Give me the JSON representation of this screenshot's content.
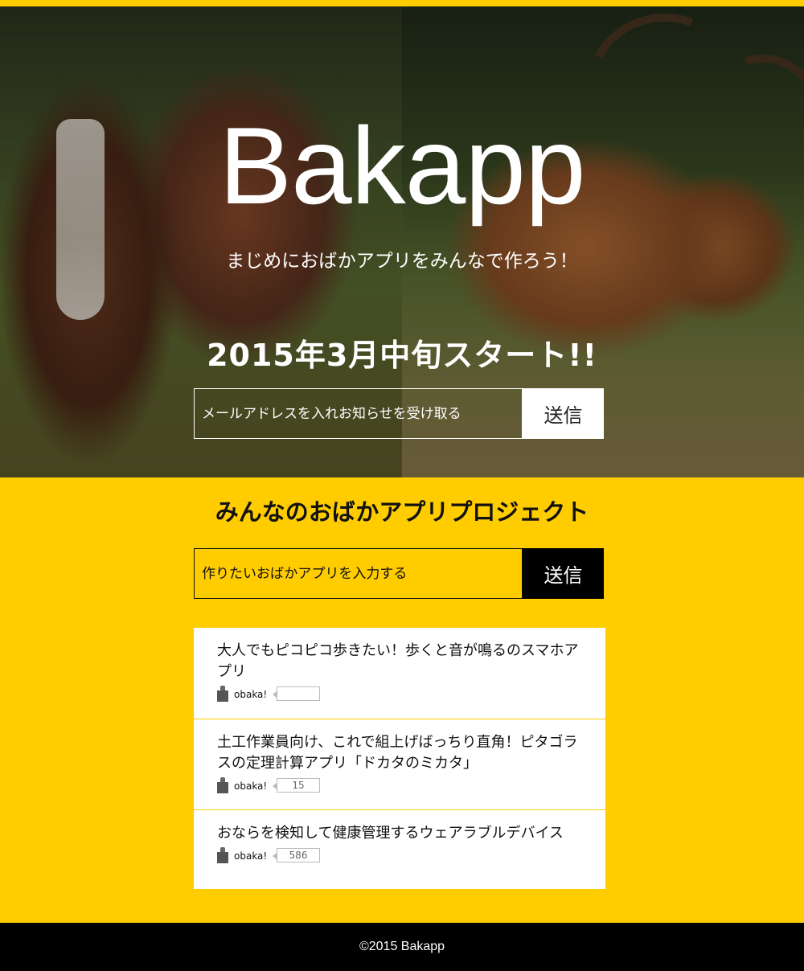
{
  "hero": {
    "logo": "Bakapp",
    "tagline": "まじめにおばかアプリをみんなで作ろう！",
    "launch": "2015年3月中旬スタート!!",
    "email_placeholder": "メールアドレスを入れお知らせを受け取る",
    "submit_label": "送信"
  },
  "project": {
    "title": "みんなのおばかアプリプロジェクト",
    "idea_placeholder": "作りたいおばかアプリを入力する",
    "submit_label": "送信",
    "ideas": [
      {
        "title": "大人でもピコピコ歩きたい！歩くと音が鳴るのスマホアプリ",
        "like_label": "obaka!",
        "count": ""
      },
      {
        "title": "土工作業員向け、これで組上げばっちり直角！ピタゴラスの定理計算アプリ「ドカタのミカタ」",
        "like_label": "obaka!",
        "count": "15"
      },
      {
        "title": "おならを検知して健康管理するウェアラブルデバイス",
        "like_label": "obaka!",
        "count": "586"
      }
    ]
  },
  "footer": {
    "copyright": "©2015 Bakapp"
  },
  "colors": {
    "accent": "#ffcc00",
    "footer": "#000000",
    "card": "#ffffff"
  },
  "icons": {
    "like": "thumbs-up-icon"
  }
}
